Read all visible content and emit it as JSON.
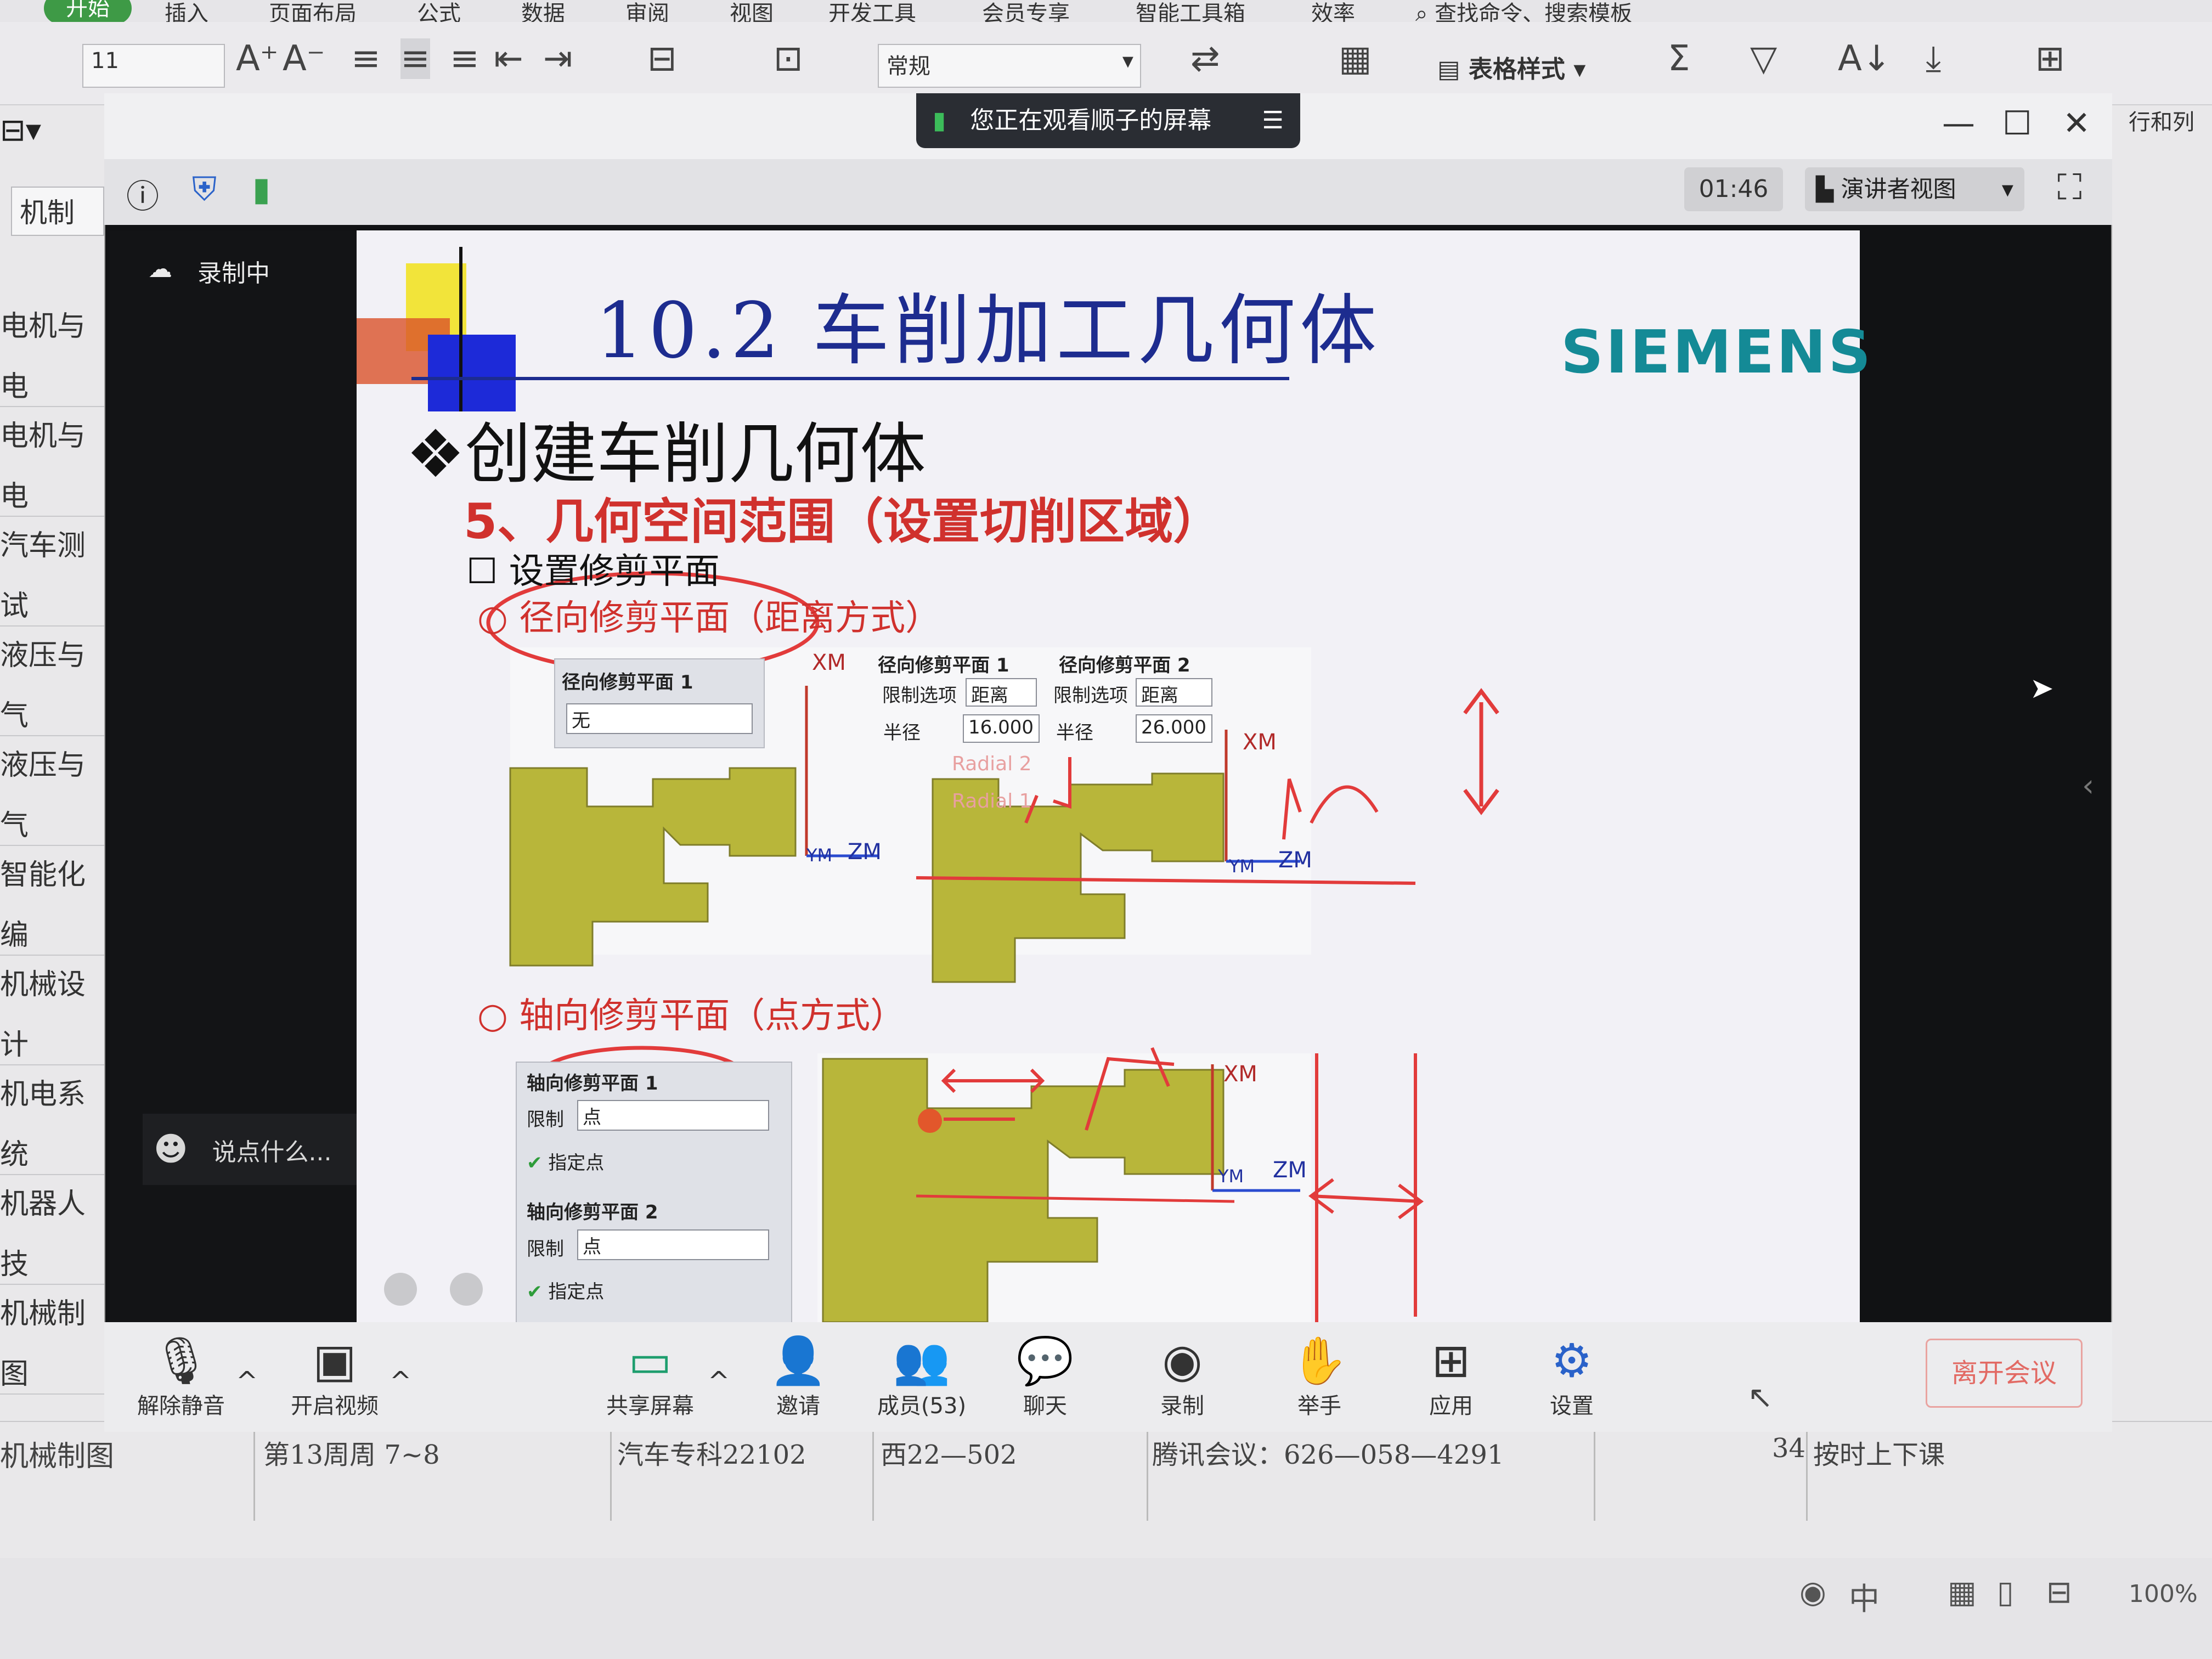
{
  "ribbon": {
    "tabs": [
      "开始",
      "插入",
      "页面布局",
      "公式",
      "数据",
      "审阅",
      "视图",
      "开发工具",
      "会员专享",
      "智能工具箱",
      "效率"
    ],
    "search_placeholder": "查找命令、搜索模板",
    "font_size": "11",
    "number_format": "常规",
    "table_style_label": "表格样式",
    "rowcol_label": "行和列"
  },
  "sheet": {
    "cell_tab": "机制",
    "row_labels": [
      "电机与电",
      "电机与电",
      "汽车测试",
      "液压与气",
      "液压与气",
      "智能化编",
      "机械设计",
      "机电系统",
      "机器人技",
      "机械制图"
    ],
    "bottom_row": {
      "col1": "机械制图",
      "col2": "第13周周 7~8",
      "col3": "汽车专科22102",
      "col4": "西22—502",
      "col5": "腾讯会议：626—058—4291",
      "col6": "34",
      "col7": "按时上下课"
    },
    "zoom": "100%"
  },
  "meeting": {
    "share_banner": "您正在观看顺子的屏幕",
    "timer": "01:46",
    "view_mode": "演讲者视图",
    "recording_label": "录制中",
    "chat_placeholder": "说点什么...",
    "toolbar": [
      {
        "id": "mute",
        "label": "解除静音",
        "icon": "mic-off-icon"
      },
      {
        "id": "video",
        "label": "开启视频",
        "icon": "camera-off-icon"
      },
      {
        "id": "share",
        "label": "共享屏幕",
        "icon": "screen-share-icon"
      },
      {
        "id": "invite",
        "label": "邀请",
        "icon": "invite-icon"
      },
      {
        "id": "members",
        "label": "成员(53)",
        "icon": "members-icon"
      },
      {
        "id": "chat",
        "label": "聊天",
        "icon": "chat-icon"
      },
      {
        "id": "record",
        "label": "录制",
        "icon": "record-icon"
      },
      {
        "id": "raise",
        "label": "举手",
        "icon": "hand-icon"
      },
      {
        "id": "apps",
        "label": "应用",
        "icon": "apps-icon"
      },
      {
        "id": "settings",
        "label": "设置",
        "icon": "gear-icon"
      }
    ],
    "leave_label": "离开会议"
  },
  "slide": {
    "title": "10.2 车削加工几何体",
    "brand": "SIEMENS",
    "heading": "❖创建车削几何体",
    "subheading": "5、几何空间范围（设置切削区域）",
    "item": "☐ 设置修剪平面",
    "radial_option": "○ 径向修剪平面（距离方式）",
    "axial_option": "○ 轴向修剪平面（点方式）",
    "radial_panel": {
      "title": "径向修剪平面 1",
      "value": "无"
    },
    "radial_trim1": {
      "title": "径向修剪平面 1",
      "limit_label": "限制选项",
      "limit": "距离",
      "radius_label": "半径",
      "radius": "16.000"
    },
    "radial_trim2": {
      "title": "径向修剪平面 2",
      "limit_label": "限制选项",
      "limit": "距离",
      "radius_label": "半径",
      "radius": "26.000"
    },
    "axial_panel1": {
      "title": "轴向修剪平面 1",
      "limit_label": "限制",
      "limit": "点",
      "point_label": "指定点"
    },
    "axial_panel2": {
      "title": "轴向修剪平面 2",
      "limit_label": "限制",
      "limit": "点",
      "point_label": "指定点"
    },
    "axes": {
      "xm": "XM",
      "ym": "YM",
      "zm": "ZM"
    },
    "faint_labels": {
      "radial2": "Radial 2",
      "radial1": "Radial 1"
    }
  },
  "colors": {
    "title_blue": "#1d2c8f",
    "red": "#d0312d",
    "siemens_teal": "#148a96",
    "part_olive": "#b8b63a",
    "ink_red": "#e23b3b"
  }
}
